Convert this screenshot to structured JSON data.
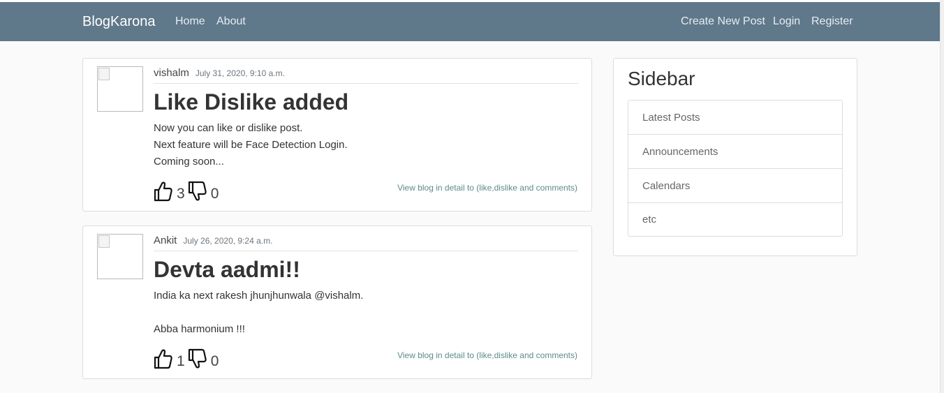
{
  "navbar": {
    "brand": "BlogKarona",
    "left_links": [
      "Home",
      "About"
    ],
    "right_links": [
      "Create New Post",
      "Login",
      "Register"
    ]
  },
  "posts": [
    {
      "author": "vishalm",
      "date": "July 31, 2020, 9:10 a.m.",
      "title": "Like Dislike added",
      "body": "Now you can like or dislike post.\nNext feature will be Face Detection Login.\nComing soon...",
      "likes": "3",
      "dislikes": "0",
      "detail_link": "View blog in detail to (like,dislike and comments)"
    },
    {
      "author": "Ankit",
      "date": "July 26, 2020, 9:24 a.m.",
      "title": "Devta aadmi!!",
      "body": "India ka next rakesh jhunjhunwala @vishalm.\n\nAbba harmonium !!!",
      "likes": "1",
      "dislikes": "0",
      "detail_link": "View blog in detail to (like,dislike and comments)"
    }
  ],
  "sidebar": {
    "title": "Sidebar",
    "items": [
      "Latest Posts",
      "Announcements",
      "Calendars",
      "etc"
    ]
  },
  "colors": {
    "navbar_bg": "#5f788a",
    "link_accent": "#5e8a8a"
  },
  "icons": [
    "thumbs-up-icon",
    "thumbs-down-icon",
    "broken-image-icon"
  ]
}
